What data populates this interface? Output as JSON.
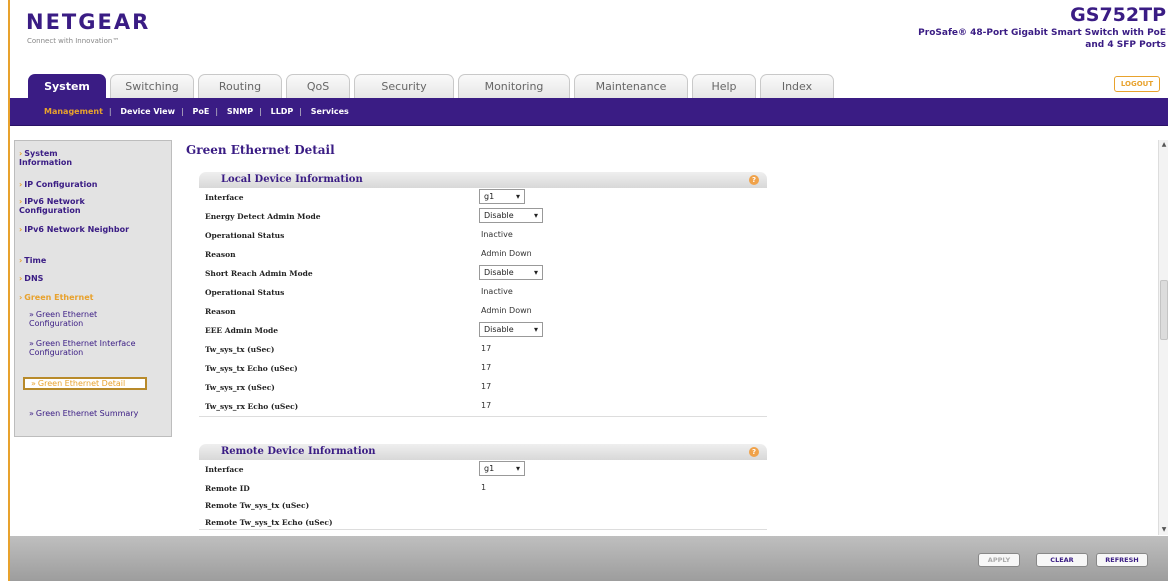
{
  "brand": {
    "logo": "NETGEAR",
    "tagline": "Connect with Innovation™"
  },
  "device": {
    "model": "GS752TP",
    "description": "ProSafe® 48-Port Gigabit Smart Switch with PoE and 4 SFP Ports"
  },
  "tabs": [
    "System",
    "Switching",
    "Routing",
    "QoS",
    "Security",
    "Monitoring",
    "Maintenance",
    "Help",
    "Index"
  ],
  "logout_label": "LOGOUT",
  "subnav": [
    "Management",
    "Device View",
    "PoE",
    "SNMP",
    "LLDP",
    "Services"
  ],
  "sidebar": {
    "items": [
      "System Information",
      "IP Configuration",
      "IPv6 Network Configuration",
      "IPv6 Network Neighbor",
      "Time",
      "DNS",
      "Green Ethernet"
    ],
    "subitems": [
      "Green Ethernet Configuration",
      "Green Ethernet Interface Configuration",
      "Green Ethernet Detail",
      "Green Ethernet Summary"
    ]
  },
  "page": {
    "title": "Green Ethernet Detail"
  },
  "local": {
    "title": "Local Device Information",
    "interface_label": "Interface",
    "interface_value": "g1",
    "energy_label": "Energy Detect Admin Mode",
    "energy_value": "Disable",
    "op_status1_label": "Operational Status",
    "op_status1_value": "Inactive",
    "reason1_label": "Reason",
    "reason1_value": "Admin Down",
    "short_reach_label": "Short Reach Admin Mode",
    "short_reach_value": "Disable",
    "op_status2_label": "Operational Status",
    "op_status2_value": "Inactive",
    "reason2_label": "Reason",
    "reason2_value": "Admin Down",
    "eee_label": "EEE Admin Mode",
    "eee_value": "Disable",
    "tw_tx_label": "Tw_sys_tx (uSec)",
    "tw_tx_value": "17",
    "tw_tx_echo_label": "Tw_sys_tx Echo (uSec)",
    "tw_tx_echo_value": "17",
    "tw_rx_label": "Tw_sys_rx (uSec)",
    "tw_rx_value": "17",
    "tw_rx_echo_label": "Tw_sys_rx Echo (uSec)",
    "tw_rx_echo_value": "17"
  },
  "remote": {
    "title": "Remote Device Information",
    "interface_label": "Interface",
    "interface_value": "g1",
    "remote_id_label": "Remote ID",
    "remote_id_value": "1",
    "remote_tx_label": "Remote Tw_sys_tx (uSec)",
    "remote_tx_echo_label": "Remote Tw_sys_tx Echo (uSec)"
  },
  "footer": {
    "apply": "APPLY",
    "clear": "CLEAR",
    "refresh": "REFRESH"
  },
  "colors": {
    "brand_purple": "#3a1c84",
    "accent_orange": "#e8a22d"
  }
}
